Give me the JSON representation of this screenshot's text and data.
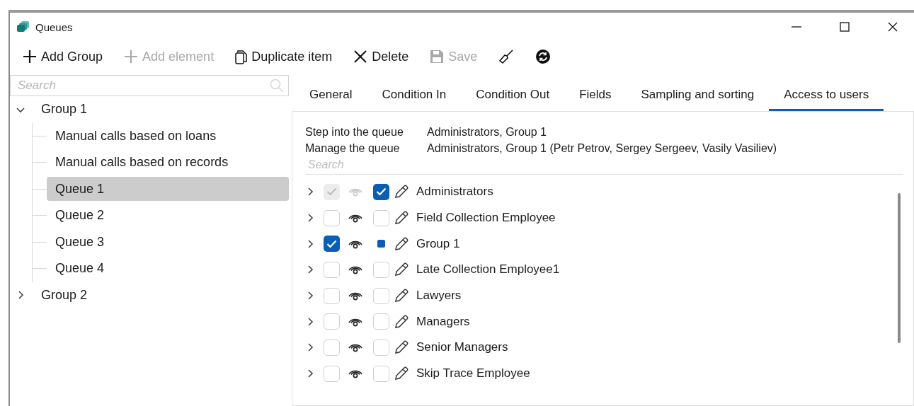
{
  "window": {
    "title": "Queues"
  },
  "toolbar": [
    {
      "kind": "add",
      "label": "Add Group",
      "disabled": false
    },
    {
      "kind": "add",
      "label": "Add element",
      "disabled": true
    },
    {
      "kind": "duplicate",
      "label": "Duplicate item",
      "disabled": false
    },
    {
      "kind": "delete",
      "label": "Delete",
      "disabled": false
    },
    {
      "kind": "save",
      "label": "Save",
      "disabled": true
    },
    {
      "kind": "brush",
      "disabled": false
    },
    {
      "kind": "refresh",
      "disabled": false
    }
  ],
  "sidebar": {
    "search": {
      "placeholder": "Search"
    },
    "tree": [
      {
        "label": "Group 1",
        "expanded": true,
        "selected": false,
        "children": [
          {
            "label": "Manual calls based on loans",
            "selected": false
          },
          {
            "label": "Manual calls based on records",
            "selected": false
          },
          {
            "label": "Queue 1",
            "selected": true
          },
          {
            "label": "Queue 2",
            "selected": false
          },
          {
            "label": "Queue 3",
            "selected": false
          },
          {
            "label": "Queue 4",
            "selected": false
          }
        ]
      },
      {
        "label": "Group 2",
        "expanded": false,
        "selected": false
      }
    ]
  },
  "tabs": [
    {
      "label": "General",
      "selected": false
    },
    {
      "label": "Condition In",
      "selected": false
    },
    {
      "label": "Condition Out",
      "selected": false
    },
    {
      "label": "Fields",
      "selected": false
    },
    {
      "label": "Sampling and sorting",
      "selected": false
    },
    {
      "label": "Access to users",
      "selected": true
    }
  ],
  "access": {
    "summary": [
      {
        "label": "Step into the queue",
        "value": "Administrators, Group 1"
      },
      {
        "label": "Manage the queue",
        "value": "Administrators, Group 1 (Petr Petrov, Sergey Sergeev, Vasily Vasiliev)"
      }
    ],
    "search": {
      "placeholder": "Search"
    },
    "users": [
      {
        "name": "Administrators",
        "view_checked": true,
        "view_disabled": true,
        "manage_checked": true,
        "manage_indeterminate": false
      },
      {
        "name": "Field Collection Employee",
        "view_checked": false,
        "view_disabled": false,
        "manage_checked": false,
        "manage_indeterminate": false
      },
      {
        "name": "Group 1",
        "view_checked": true,
        "view_disabled": false,
        "manage_checked": true,
        "manage_indeterminate": true
      },
      {
        "name": "Late Collection Employee1",
        "view_checked": false,
        "view_disabled": false,
        "manage_checked": false,
        "manage_indeterminate": false
      },
      {
        "name": "Lawyers",
        "view_checked": false,
        "view_disabled": false,
        "manage_checked": false,
        "manage_indeterminate": false
      },
      {
        "name": "Managers",
        "view_checked": false,
        "view_disabled": false,
        "manage_checked": false,
        "manage_indeterminate": false
      },
      {
        "name": "Senior Managers",
        "view_checked": false,
        "view_disabled": false,
        "manage_checked": false,
        "manage_indeterminate": false
      },
      {
        "name": "Skip Trace Employee",
        "view_checked": false,
        "view_disabled": false,
        "manage_checked": false,
        "manage_indeterminate": false
      }
    ]
  }
}
